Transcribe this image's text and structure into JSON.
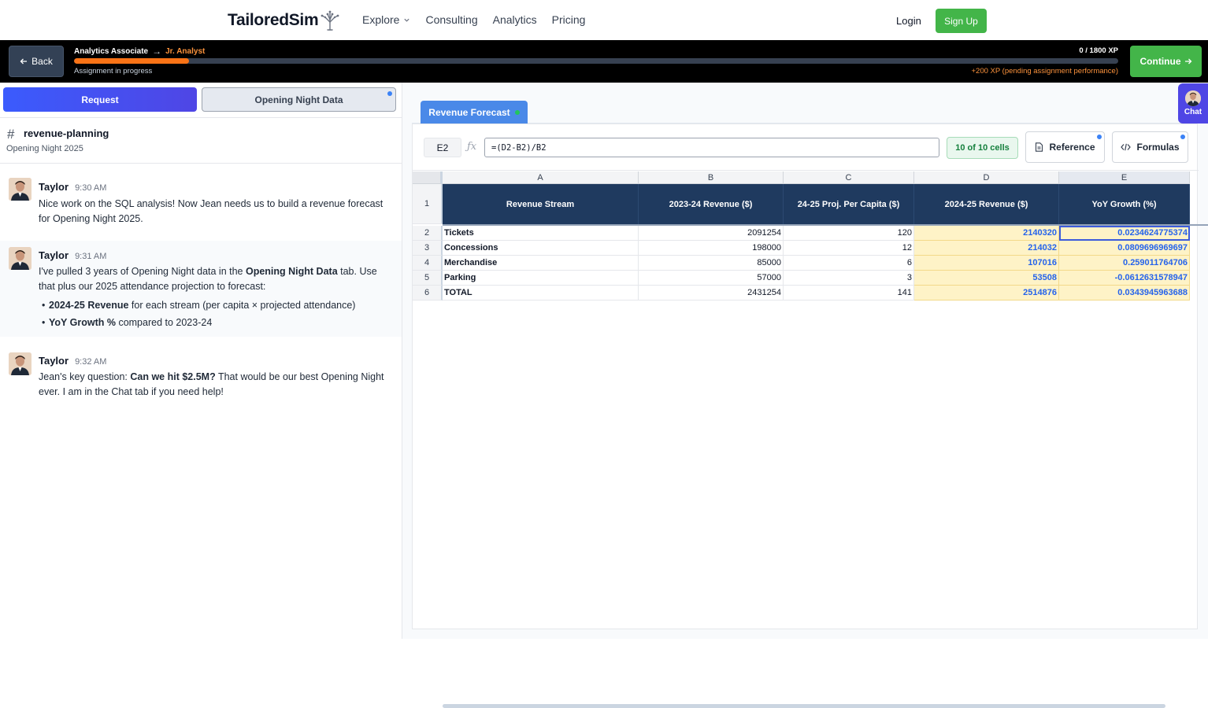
{
  "brand": {
    "name": "TailoredSim"
  },
  "nav": {
    "links": [
      {
        "label": "Explore",
        "dropdown": true
      },
      {
        "label": "Consulting"
      },
      {
        "label": "Analytics"
      },
      {
        "label": "Pricing"
      }
    ],
    "login": "Login",
    "signup": "Sign Up"
  },
  "progress": {
    "back_label": "Back",
    "current_role": "Analytics Associate",
    "arrow": "→",
    "next_role": "Jr. Analyst",
    "xp_text": "0 / 1800 XP",
    "status": "Assignment in progress",
    "pending": "+200 XP (pending assignment performance)",
    "fill_fraction": 0.11,
    "continue_label": "Continue"
  },
  "left_tabs": {
    "request": "Request",
    "data": "Opening Night Data"
  },
  "channel": {
    "hash": "#",
    "name": "revenue-planning",
    "subtitle": "Opening Night 2025"
  },
  "messages": [
    {
      "author": "Taylor",
      "time": "9:30 AM",
      "text": "Nice work on the SQL analysis! Now Jean needs us to build a revenue forecast for Opening Night 2025."
    },
    {
      "author": "Taylor",
      "time": "9:31 AM",
      "p1": "I've pulled 3 years of Opening Night data in the ",
      "p1_bold": "Opening Night Data",
      "p1_end": " tab. Use that plus our 2025 attendance projection to forecast:",
      "b1_bold": "2024-25 Revenue",
      "b1_rest": " for each stream (per capita × projected attendance)",
      "b2_bold": "YoY Growth %",
      "b2_rest": " compared to 2023-24"
    },
    {
      "author": "Taylor",
      "time": "9:32 AM",
      "p1": "Jean's key question: ",
      "p1_bold": "Can we hit $2.5M?",
      "p1_end": " That would be our best Opening Night ever. I am in the Chat tab if you need help!"
    }
  ],
  "sheet": {
    "tab_name": "Revenue Forecast",
    "cell_ref": "E2",
    "fx": "ƒx",
    "formula": "=(D2-B2)/B2",
    "cells_badge": "10 of 10 cells",
    "reference_label": "Reference",
    "formulas_label": "Formulas",
    "columns": [
      "A",
      "B",
      "C",
      "D",
      "E"
    ],
    "row_numbers": [
      "1",
      "2",
      "3",
      "4",
      "5",
      "6"
    ],
    "headers": [
      "Revenue Stream",
      "2023-24 Revenue ($)",
      "24-25 Proj. Per Capita ($)",
      "2024-25 Revenue ($)",
      "YoY Growth (%)"
    ],
    "rows": [
      [
        "Tickets",
        "2091254",
        "120",
        "2140320",
        "0.0234624775374"
      ],
      [
        "Concessions",
        "198000",
        "12",
        "214032",
        "0.0809696969697"
      ],
      [
        "Merchandise",
        "85000",
        "6",
        "107016",
        "0.259011764706"
      ],
      [
        "Parking",
        "57000",
        "3",
        "53508",
        "-0.0612631578947"
      ],
      [
        "TOTAL",
        "2431254",
        "141",
        "2514876",
        "0.0343945963688"
      ]
    ]
  },
  "chat": {
    "label": "Chat"
  },
  "colors": {
    "accent": "#4f46e5",
    "success": "#43b549",
    "header_navy": "#1f3a5f",
    "xp_orange": "#f97316"
  }
}
